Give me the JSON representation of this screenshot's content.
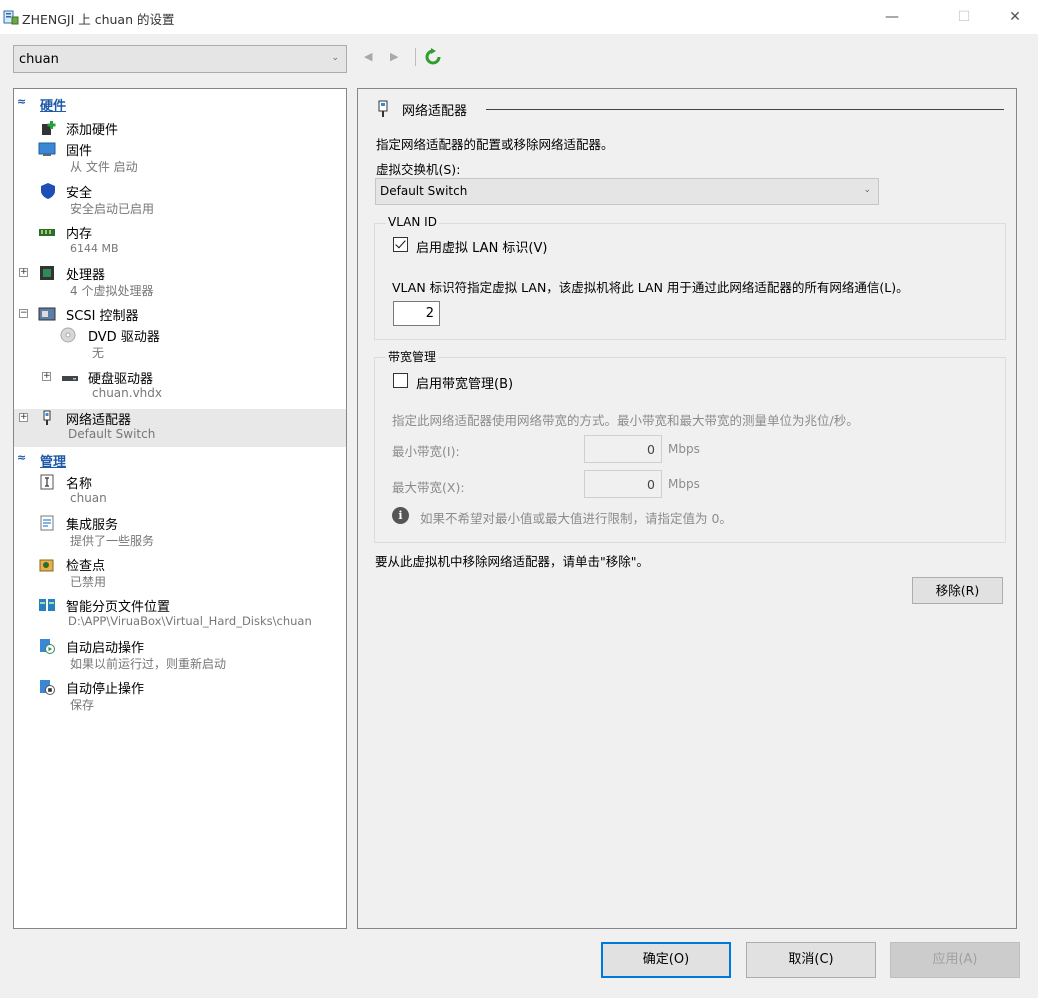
{
  "window": {
    "title": "ZHENGJI 上 chuan 的设置",
    "minimize": "—",
    "maximize": "☐",
    "close": "✕"
  },
  "vm_selector": {
    "value": "chuan"
  },
  "tree": {
    "hardware_header": "硬件",
    "management_header": "管理",
    "hardware_items": [
      {
        "name": "添加硬件",
        "sub": ""
      },
      {
        "name": "固件",
        "sub": "从 文件 启动"
      },
      {
        "name": "安全",
        "sub": "安全启动已启用"
      },
      {
        "name": "内存",
        "sub": "6144 MB"
      },
      {
        "name": "处理器",
        "sub": "4 个虚拟处理器"
      },
      {
        "name": "SCSI 控制器",
        "sub": ""
      },
      {
        "name": "DVD 驱动器",
        "sub": "无"
      },
      {
        "name": "硬盘驱动器",
        "sub": "chuan.vhdx"
      },
      {
        "name": "网络适配器",
        "sub": "Default Switch"
      }
    ],
    "management_items": [
      {
        "name": "名称",
        "sub": "chuan"
      },
      {
        "name": "集成服务",
        "sub": "提供了一些服务"
      },
      {
        "name": "检查点",
        "sub": "已禁用"
      },
      {
        "name": "智能分页文件位置",
        "sub": "D:\\APP\\ViruaBox\\Virtual_Hard_Disks\\chuan"
      },
      {
        "name": "自动启动操作",
        "sub": "如果以前运行过，则重新启动"
      },
      {
        "name": "自动停止操作",
        "sub": "保存"
      }
    ]
  },
  "panel": {
    "title": "网络适配器",
    "description": "指定网络适配器的配置或移除网络适配器。",
    "switch_label": "虚拟交换机(S):",
    "switch_value": "Default Switch",
    "vlan": {
      "group_title": "VLAN ID",
      "enable_label": "启用虚拟 LAN 标识(V)",
      "enabled": true,
      "description": "VLAN 标识符指定虚拟 LAN，该虚拟机将此 LAN 用于通过此网络适配器的所有网络通信(L)。",
      "id_value": "2"
    },
    "bandwidth": {
      "group_title": "带宽管理",
      "enable_label": "启用带宽管理(B)",
      "enabled": false,
      "description": "指定此网络适配器使用网络带宽的方式。最小带宽和最大带宽的测量单位为兆位/秒。",
      "min_label": "最小带宽(I):",
      "min_value": "0",
      "max_label": "最大带宽(X):",
      "max_value": "0",
      "unit": "Mbps",
      "info_icon": "i",
      "info": "如果不希望对最小值或最大值进行限制，请指定值为 0。"
    },
    "remove_description": "要从此虚拟机中移除网络适配器，请单击\"移除\"。",
    "remove_button": "移除(R)"
  },
  "footer": {
    "ok": "确定(O)",
    "cancel": "取消(C)",
    "apply": "应用(A)"
  }
}
